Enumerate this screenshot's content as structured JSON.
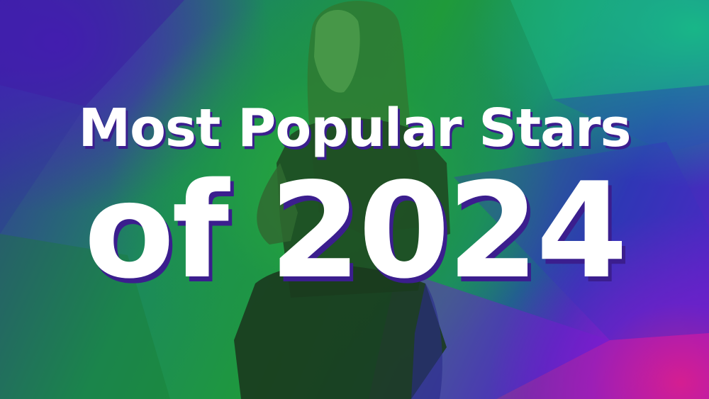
{
  "banner": {
    "title_line1": "Most Popular Stars",
    "title_line2": "of 2024"
  },
  "colors": {
    "text": "#ffffff",
    "text_shadow": "#3b1e8e",
    "green": "#1f9a3a",
    "purple": "#4b1ebe",
    "magenta": "#e61e82",
    "teal": "#14be82"
  }
}
